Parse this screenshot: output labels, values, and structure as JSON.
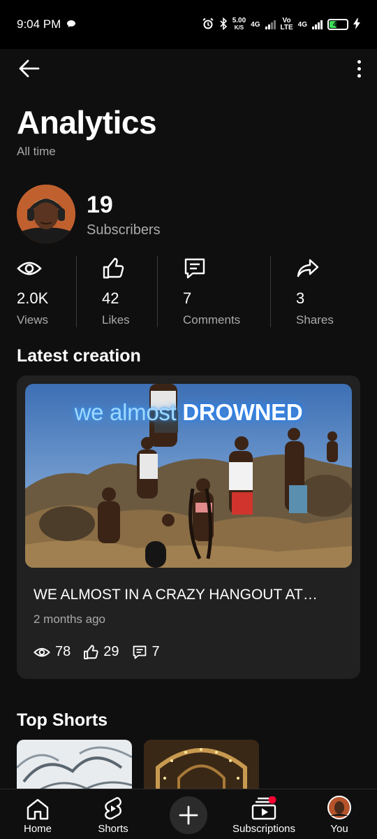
{
  "status_bar": {
    "time": "9:04 PM",
    "speed_value": "5.00",
    "speed_unit": "K/S",
    "net1": "4G",
    "volte_top": "Vo",
    "volte_bottom": "LTE",
    "net2": "4G",
    "battery": "43",
    "battery_level": 0.43
  },
  "header": {
    "title": "Analytics",
    "period": "All time"
  },
  "channel": {
    "subscribers_count": "19",
    "subscribers_label": "Subscribers"
  },
  "stats": [
    {
      "icon": "eye-icon",
      "value": "2.0K",
      "label": "Views"
    },
    {
      "icon": "thumbs-up-icon",
      "value": "42",
      "label": "Likes"
    },
    {
      "icon": "comment-icon",
      "value": "7",
      "label": "Comments"
    },
    {
      "icon": "share-icon",
      "value": "3",
      "label": "Shares"
    }
  ],
  "latest": {
    "section_title": "Latest creation",
    "thumb_text_1": "we almost",
    "thumb_text_2": "DROWNED",
    "title": "WE ALMOST IN A CRAZY HANGOUT AT…",
    "age": "2 months ago",
    "views": "78",
    "likes": "29",
    "comments": "7"
  },
  "top_shorts": {
    "section_title": "Top Shorts"
  },
  "nav": {
    "home": "Home",
    "shorts": "Shorts",
    "subscriptions": "Subscriptions",
    "you": "You"
  },
  "colors": {
    "background": "#0f0f0f",
    "card": "#212121",
    "secondary_text": "#aaaaaa",
    "notification_dot": "#ff0033",
    "battery_fill": "#3ddc5a"
  }
}
